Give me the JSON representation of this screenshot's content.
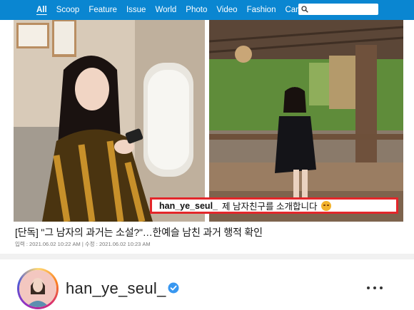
{
  "nav": {
    "items": [
      "All",
      "Scoop",
      "Feature",
      "Issue",
      "World",
      "Photo",
      "Video",
      "Fashion",
      "Can@"
    ],
    "active": "All",
    "bg_color": "#0a86d1"
  },
  "search": {
    "placeholder": "",
    "icon": "search-icon"
  },
  "photo_caption": {
    "username": "han_ye_seul_",
    "text": "제 남자친구를 소개합니다",
    "emoji": "smiling-face-with-hearts",
    "border_color": "#e3262a"
  },
  "article": {
    "headline": "[단독] \"그 남자의 과거는 소설?\"…한예슬 남친 과거 행적 확인",
    "meta": "입력 : 2021.06.02 10:22 AM | 수정 : 2021.06.02 10:23 AM"
  },
  "profile": {
    "username": "han_ye_seul_",
    "verified": true,
    "more_icon": "more-horizontal-icon"
  }
}
